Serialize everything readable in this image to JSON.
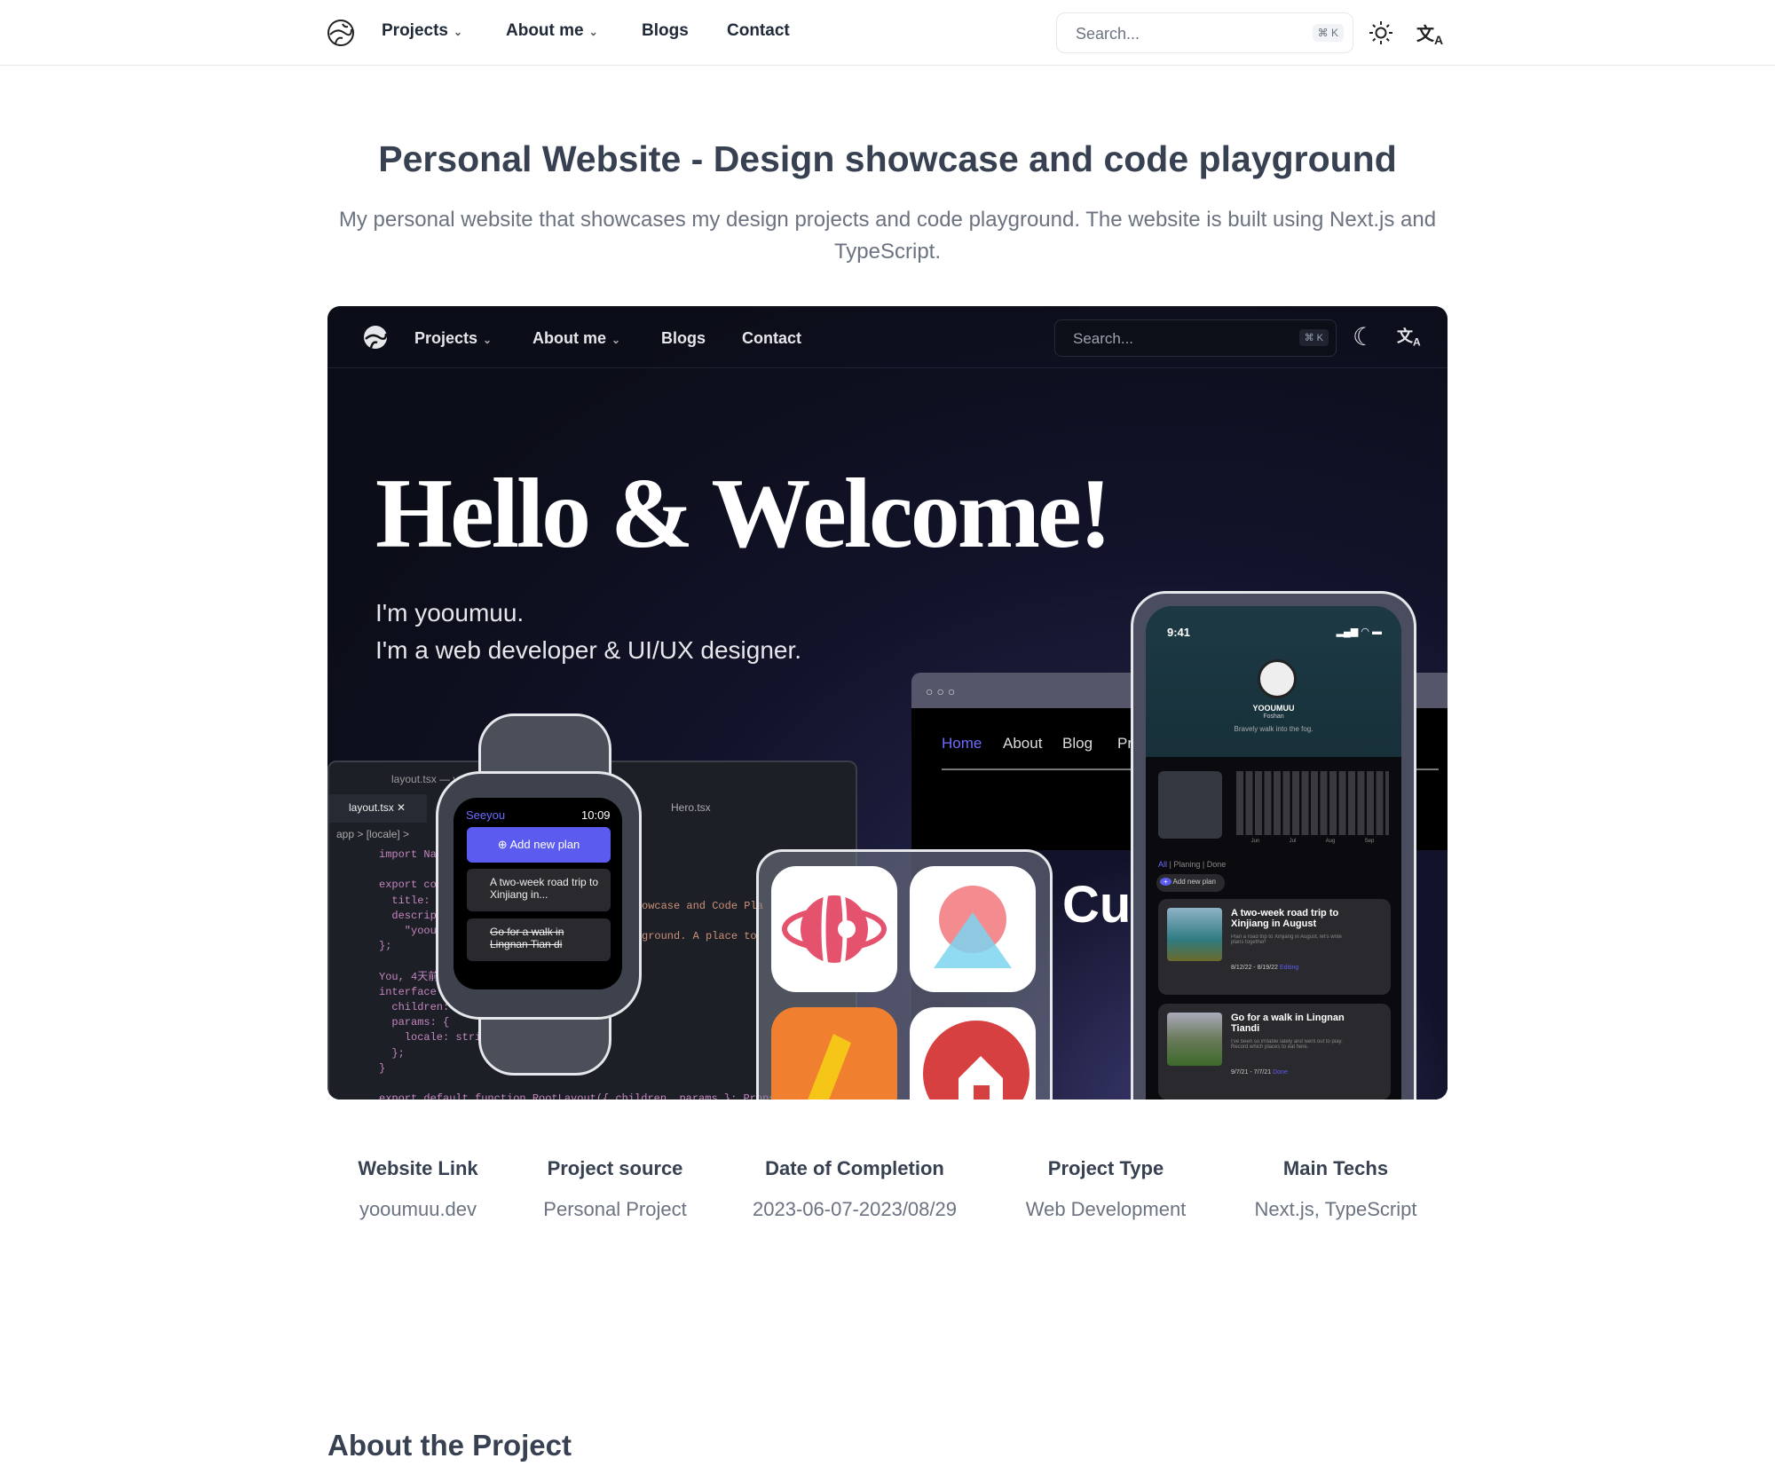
{
  "nav": {
    "items": [
      {
        "label": "Projects",
        "dropdown": true
      },
      {
        "label": "About me",
        "dropdown": true
      },
      {
        "label": "Blogs"
      },
      {
        "label": "Contact"
      }
    ],
    "search_placeholder": "Search...",
    "shortcut": "⌘ K",
    "theme_icon": "sun-icon",
    "lang_icon": "translate-icon"
  },
  "page": {
    "title": "Personal Website - Design showcase and code playground",
    "subtitle": "My personal website that showcases my design projects and code playground. The website is built using Next.js and TypeScript."
  },
  "hero": {
    "nav": {
      "items": [
        "Projects",
        "About me",
        "Blogs",
        "Contact"
      ],
      "search_placeholder": "Search...",
      "shortcut": "⌘ K",
      "theme_icon": "moon-icon"
    },
    "heading": "Hello & Welcome!",
    "intro1": "I'm yooumuu.",
    "intro2": "I'm a web developer & UI/UX designer.",
    "editor": {
      "title": "layout.tsx — yo",
      "tab1": "layout.tsx",
      "tab2": "Hero.tsx",
      "breadcrumb": "app > [locale] >",
      "lines": [
        "import Nav",
        "",
        "export con",
        "  title: \"",
        "  descript",
        "    \"yooum",
        "};",
        "",
        "You, 4天前 | 1 a",
        "interface P",
        "  children:",
        "  params: {",
        "    locale: strin",
        "  };",
        "}",
        "",
        "export default function RootLayout({ children, params }: Props)"
      ],
      "right1": "owcase and Code Pla",
      "right2": "ground. A place to"
    },
    "watch": {
      "app": "Seeyou",
      "time": "10:09",
      "add": "Add new plan",
      "item1": "A two-week road trip to Xinjiang in...",
      "item2": "Go for a walk in Lingnan Tian di"
    },
    "browser": {
      "links": [
        "Home",
        "About",
        "Blog",
        "Pr"
      ],
      "big": "Cus"
    },
    "phone": {
      "time": "9:41",
      "name": "YOOUMUU",
      "location": "Foshan",
      "bio": "Bravely walk into the fog.",
      "months": [
        "Jun",
        "Jul",
        "Aug",
        "Sep"
      ],
      "filters": [
        "All",
        "Planing",
        "Done"
      ],
      "add": "Add new plan",
      "cards": [
        {
          "title": "A two-week road trip to Xinjiang in August",
          "desc": "Plan a road trip to Xinjiang in August, let's write plans together!",
          "dates": "8/12/22 - 8/19/22",
          "status": "Editing"
        },
        {
          "title": "Go for a walk in Lingnan Tiandi",
          "desc": "I've been so irritable lately and went out to play. Record which places to eat here.",
          "dates": "9/7/21 - 7/7/21",
          "status": "Done"
        }
      ]
    }
  },
  "meta": [
    {
      "label": "Website Link",
      "value": "yooumuu.dev"
    },
    {
      "label": "Project source",
      "value": "Personal Project"
    },
    {
      "label": "Date of Completion",
      "value": "2023-06-07-2023/08/29"
    },
    {
      "label": "Project Type",
      "value": "Web Development"
    },
    {
      "label": "Main Techs",
      "value": "Next.js, TypeScript"
    }
  ],
  "about": {
    "heading": "About the Project"
  },
  "colors": {
    "accent": "#5b5bf0",
    "text": "#374151",
    "muted": "#6b7280"
  }
}
